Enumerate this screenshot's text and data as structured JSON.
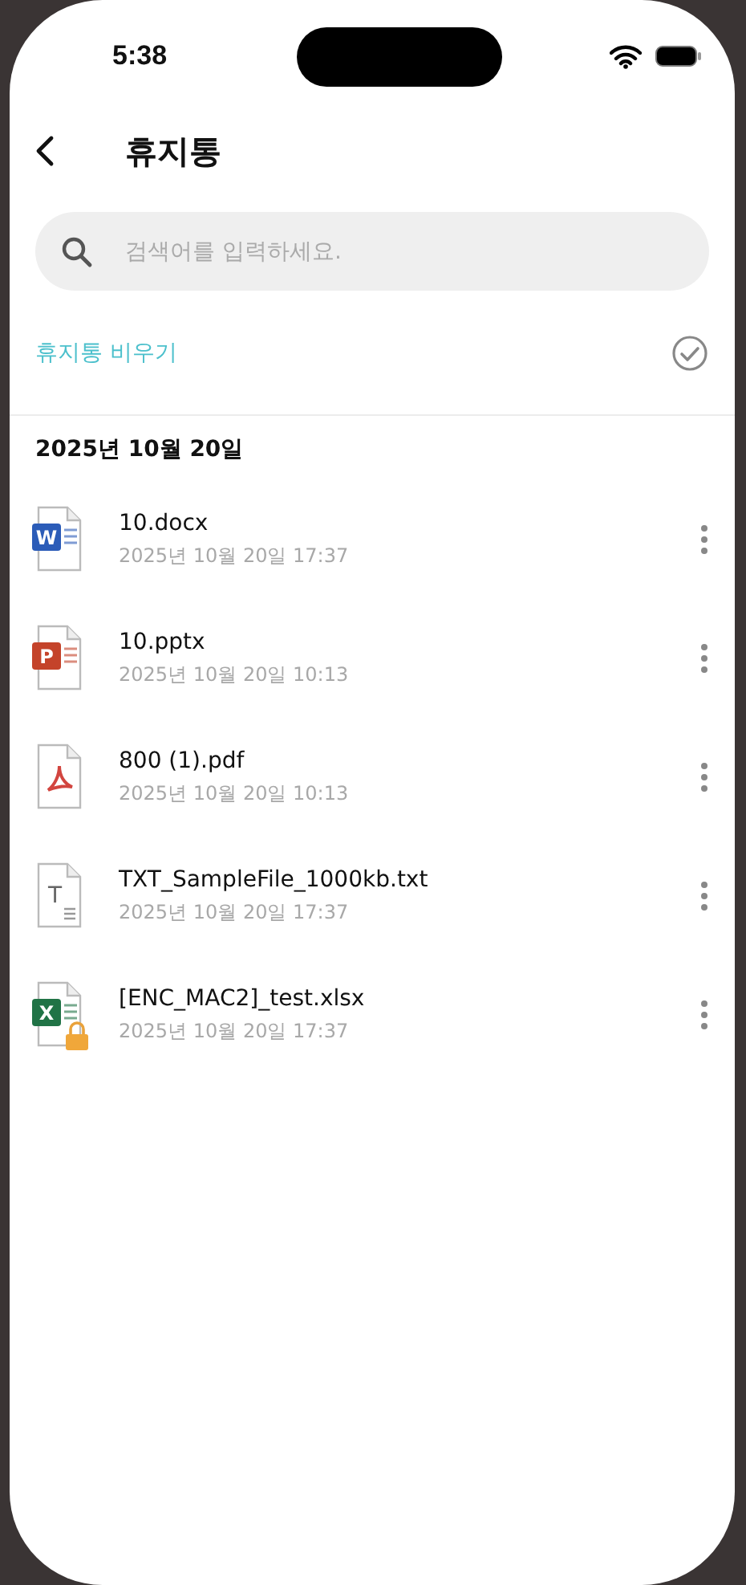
{
  "status_bar": {
    "time": "5:38"
  },
  "header": {
    "title": "휴지통"
  },
  "search": {
    "placeholder": "검색어를 입력하세요."
  },
  "empty_trash": {
    "label": "휴지통 비우기"
  },
  "groups": [
    {
      "date": "2025년 10월 20일",
      "files": [
        {
          "name": "10.docx",
          "modified": "2025년 10월 20일 17:37",
          "kind": "word",
          "icon_letter": "W",
          "locked": false
        },
        {
          "name": "10.pptx",
          "modified": "2025년 10월 20일 10:13",
          "kind": "powerpoint",
          "icon_letter": "P",
          "locked": false
        },
        {
          "name": "800 (1).pdf",
          "modified": "2025년 10월 20일 10:13",
          "kind": "pdf",
          "locked": false
        },
        {
          "name": "TXT_SampleFile_1000kb.txt",
          "modified": "2025년 10월 20일 17:37",
          "kind": "text",
          "icon_letter": "T",
          "locked": false
        },
        {
          "name": "[ENC_MAC2]_test.xlsx",
          "modified": "2025년 10월 20일 17:37",
          "kind": "excel",
          "icon_letter": "X",
          "locked": true
        }
      ]
    }
  ]
}
